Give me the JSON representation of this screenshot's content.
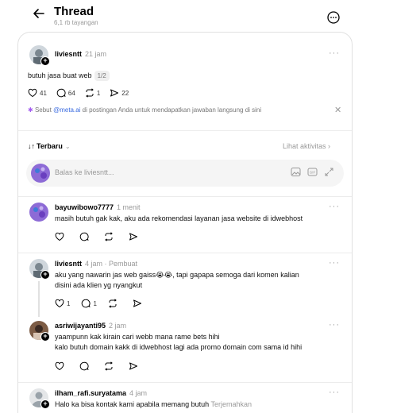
{
  "header": {
    "title": "Thread",
    "views": "6,1 rb tayangan"
  },
  "op": {
    "username": "liviesntt",
    "time": "21 jam",
    "text": "butuh jasa buat web",
    "page_pill": "1/2",
    "likes": "41",
    "comments": "64",
    "reposts": "1",
    "shares": "22"
  },
  "mention_hint": {
    "prefix": "Sebut ",
    "handle": "@meta.ai",
    "suffix": " di postingan Anda untuk mendapatkan jawaban langsung di sini"
  },
  "sort": {
    "label": "Terbaru",
    "activity": "Lihat aktivitas"
  },
  "reply_box": {
    "placeholder": "Balas ke liviesntt..."
  },
  "replies": [
    {
      "username": "bayuwibowo7777",
      "time": "1 menit",
      "text": "masih butuh gak kak, aku ada rekomendasi layanan jasa website di idwebhost"
    },
    {
      "username": "liviesntt",
      "time": "4 jam",
      "tag": "Pembuat",
      "line1": "aku yang nawarin jas web gaiss😭😭, tapi gapapa semoga dari komen kalian",
      "line2": "disini ada klien yg nyangkut",
      "likes": "1",
      "comments": "1"
    },
    {
      "username": "asriwijayanti95",
      "time": "2 jam",
      "line1": "yaampunn kak kirain cari webb mana rame bets hihi",
      "line2": "kalo butuh domain kakk di idwebhost lagi ada promo domain com sama id hihi"
    },
    {
      "username": "ilham_rafi.suryatama",
      "time": "4 jam",
      "text": "Halo ka bisa kontak kami apabila memang butuh",
      "translate": "Terjemahkan"
    }
  ],
  "colors": {
    "accent_link": "#3a6be0",
    "muted": "#999999",
    "border": "#e1e1e1"
  }
}
